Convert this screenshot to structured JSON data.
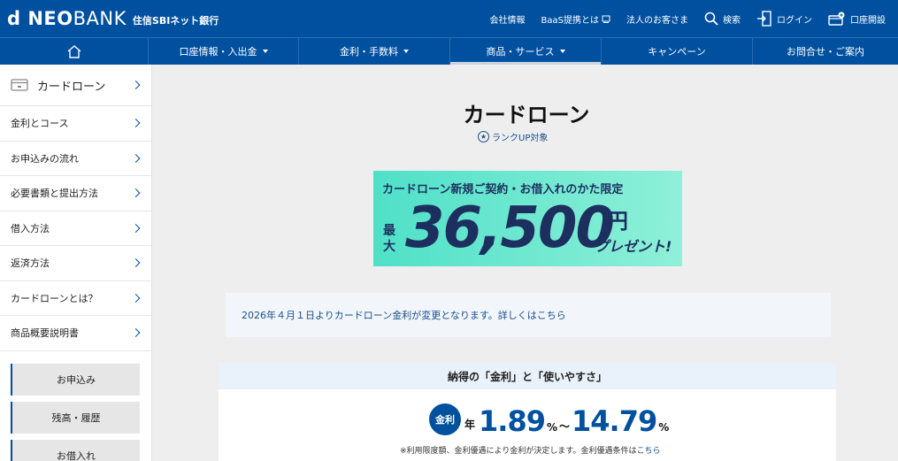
{
  "header": {
    "logo_main_bold": "d NEO",
    "logo_main_thin": "BANK",
    "logo_sub": "住信SBIネット銀行",
    "links": [
      {
        "label": "会社情報"
      },
      {
        "label": "BaaS提携とは"
      },
      {
        "label": "法人のお客さま"
      },
      {
        "label": "検索"
      },
      {
        "label": "ログイン"
      },
      {
        "label": "口座開設"
      }
    ]
  },
  "nav": {
    "home_icon": "home-icon",
    "items": [
      {
        "label": "口座情報・入出金"
      },
      {
        "label": "金利・手数料"
      },
      {
        "label": "商品・サービス"
      },
      {
        "label": "キャンペーン"
      },
      {
        "label": "お問合せ・ご案内"
      }
    ]
  },
  "sidebar": {
    "head": "カードローン",
    "items": [
      {
        "label": "金利とコース"
      },
      {
        "label": "お申込みの流れ"
      },
      {
        "label": "必要書類と提出方法"
      },
      {
        "label": "借入方法"
      },
      {
        "label": "返済方法"
      },
      {
        "label": "カードローンとは？"
      },
      {
        "label": "商品概要説明書"
      }
    ],
    "buttons": [
      {
        "label": "お申込み"
      },
      {
        "label": "残高・履歴"
      },
      {
        "label": "お借入れ"
      }
    ]
  },
  "main": {
    "title": "カードローン",
    "rank_label": "ランクUP対象",
    "banner": {
      "top": "カードローン新規ご契約・お借入れのかた限定",
      "max": "最大",
      "amount": "36,500",
      "yen": "円",
      "gift": "プレゼント!"
    },
    "notice": "2026年４月１日よりカードローン金利が変更となります。詳しくはこちら",
    "card": {
      "head": "納得の「金利」と「使いやすさ」",
      "badge": "金利",
      "prefix": "年",
      "rate_low": "1.89",
      "unit": "%",
      "tilde": "〜",
      "rate_high": "14.79",
      "note": "※利用限度額、金利優遇により金利が決定します。金利優遇条件は",
      "note_link": "こちら"
    }
  },
  "colors": {
    "brand": "#0050a0",
    "banner": "#4fe0c8",
    "banner_text": "#1d2f5f"
  }
}
